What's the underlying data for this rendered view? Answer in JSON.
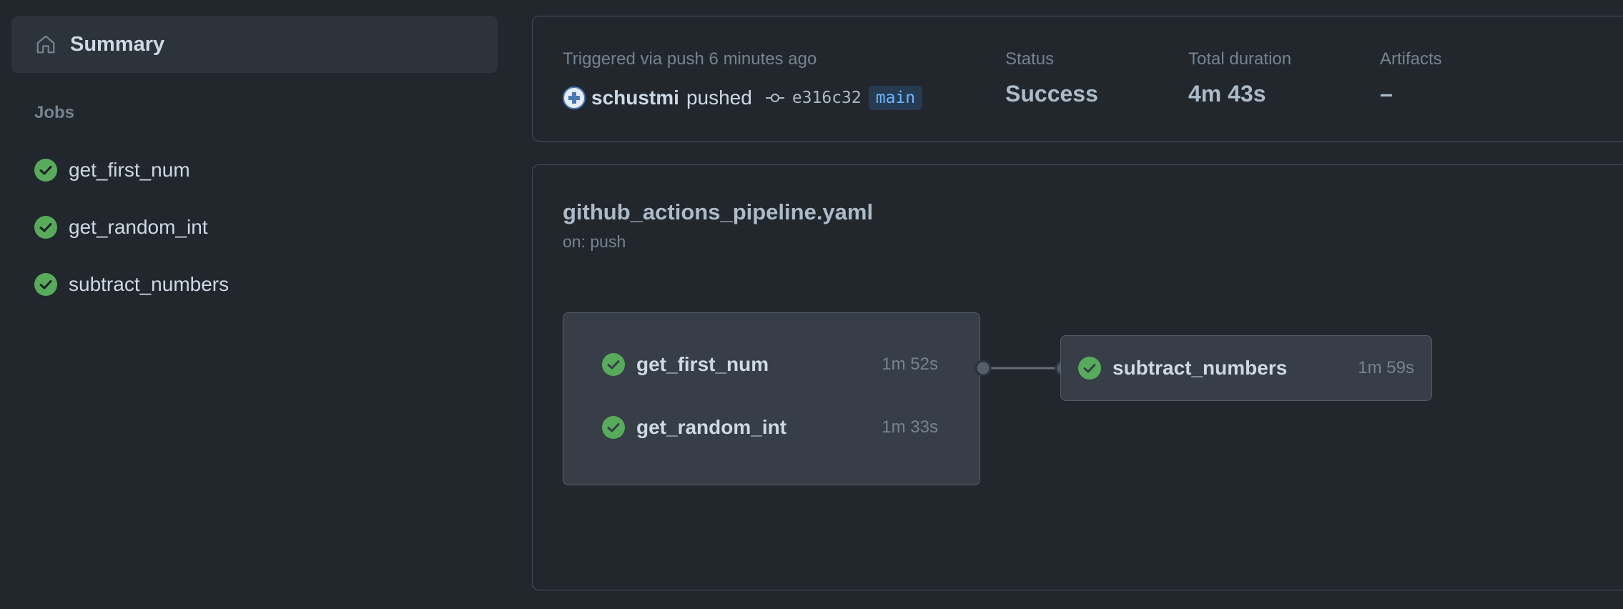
{
  "sidebar": {
    "summary_label": "Summary",
    "jobs_heading": "Jobs",
    "jobs": [
      {
        "label": "get_first_num",
        "status": "success"
      },
      {
        "label": "get_random_int",
        "status": "success"
      },
      {
        "label": "subtract_numbers",
        "status": "success"
      }
    ]
  },
  "run_summary": {
    "triggered_text": "Triggered via push 6 minutes ago",
    "user": "schustmi",
    "action": "pushed",
    "commit_sha": "e316c32",
    "branch": "main",
    "status_label": "Status",
    "status_value": "Success",
    "duration_label": "Total duration",
    "duration_value": "4m 43s",
    "artifacts_label": "Artifacts",
    "artifacts_value": "–"
  },
  "workflow": {
    "file": "github_actions_pipeline.yaml",
    "trigger": "on: push",
    "group_jobs": [
      {
        "label": "get_first_num",
        "duration": "1m 52s"
      },
      {
        "label": "get_random_int",
        "duration": "1m 33s"
      }
    ],
    "downstream_job": {
      "label": "subtract_numbers",
      "duration": "1m 59s"
    }
  },
  "colors": {
    "background": "#22272e",
    "panel": "#2d333b",
    "node": "#373e47",
    "border": "#444c56",
    "success": "#57ab5a",
    "accent": "#6cb6ff"
  },
  "icons": {
    "summary": "home-icon",
    "job_status": "check-circle-icon",
    "commit": "git-commit-icon"
  }
}
